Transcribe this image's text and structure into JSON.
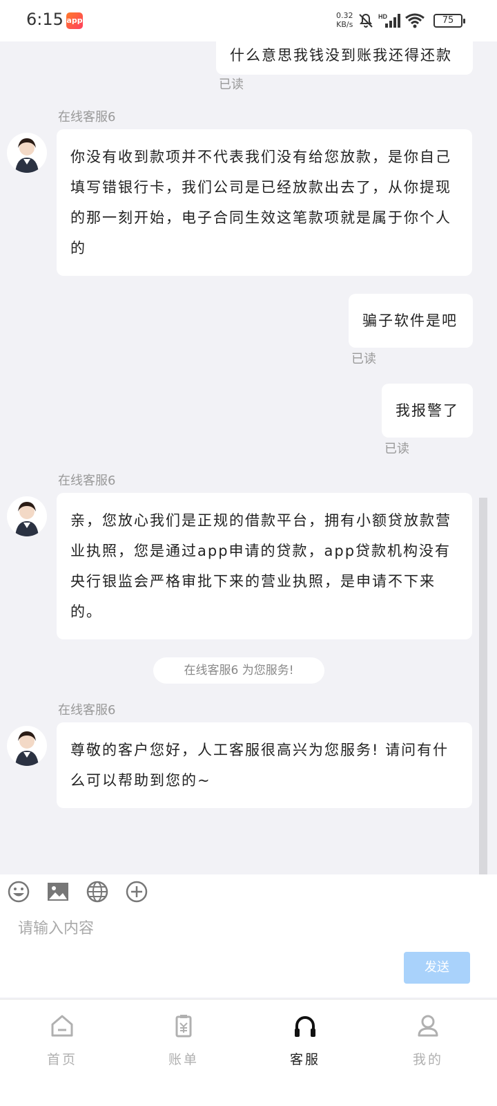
{
  "status_bar": {
    "time": "6:15",
    "net_speed_value": "0.32",
    "net_speed_unit": "KB/s",
    "battery": "75"
  },
  "chat": {
    "messages": [
      {
        "side": "right",
        "text": "什么意思我钱没到账我还得还款",
        "status": "已读"
      },
      {
        "side": "left",
        "sender": "在线客服6",
        "text": "你没有收到款项并不代表我们没有给您放款，是你自己填写错银行卡，我们公司是已经放款出去了，从你提现的那一刻开始，电子合同生效这笔款项就是属于你个人的"
      },
      {
        "side": "right",
        "text": "骗子软件是吧",
        "status": "已读"
      },
      {
        "side": "right",
        "text": "我报警了",
        "status": "已读"
      },
      {
        "side": "left",
        "sender": "在线客服6",
        "text": "亲，您放心我们是正规的借款平台，拥有小额贷放款营业执照，您是通过app申请的贷款，app贷款机构没有央行银监会严格审批下来的营业执照，是申请不下来的。"
      },
      {
        "side": "system",
        "text": "在线客服6  为您服务!"
      },
      {
        "side": "left",
        "sender": "在线客服6",
        "text": "尊敬的客户您好，人工客服很高兴为您服务! 请问有什么可以帮助到您的~"
      }
    ]
  },
  "input": {
    "placeholder": "请输入内容",
    "send_label": "发送",
    "tools": [
      "emoji-icon",
      "image-icon",
      "globe-icon",
      "plus-icon"
    ]
  },
  "tabs": [
    {
      "label": "首页",
      "icon": "home-icon",
      "active": false
    },
    {
      "label": "账单",
      "icon": "bill-icon",
      "active": false
    },
    {
      "label": "客服",
      "icon": "headset-icon",
      "active": true
    },
    {
      "label": "我的",
      "icon": "user-icon",
      "active": false
    }
  ],
  "colors": {
    "background": "#f2f2f6",
    "bubble": "#ffffff",
    "send_button": "#a9d2fb",
    "muted_text": "#999999"
  }
}
